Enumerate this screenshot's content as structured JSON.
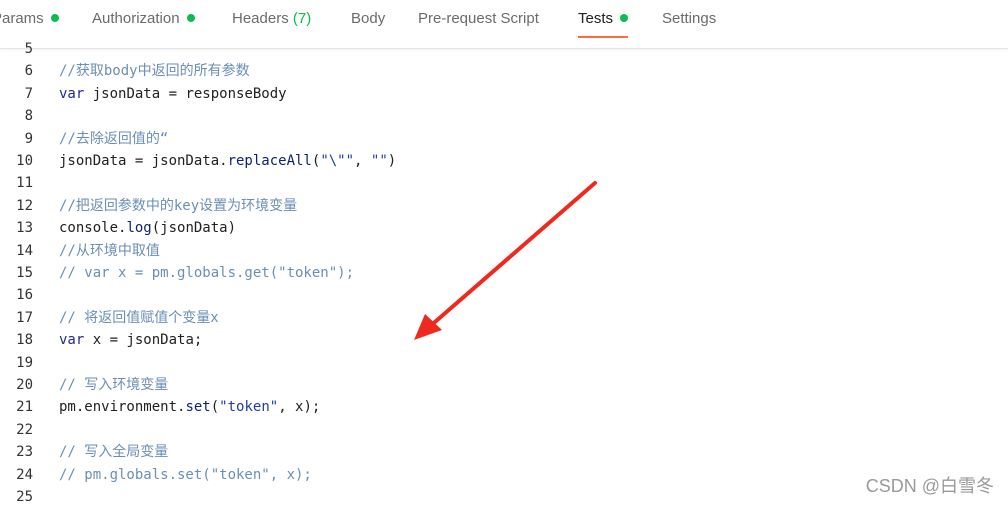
{
  "tabs": [
    {
      "label": "Params",
      "dot": true
    },
    {
      "label": "Authorization",
      "dot": true
    },
    {
      "label": "Headers",
      "count": "(7)"
    },
    {
      "label": "Body"
    },
    {
      "label": "Pre-request Script"
    },
    {
      "label": "Tests",
      "dot": true,
      "active": true
    },
    {
      "label": "Settings"
    }
  ],
  "lines": [
    {
      "n": "5",
      "t": ""
    },
    {
      "n": "6",
      "t": "//获取body中返回的所有参数"
    },
    {
      "n": "7",
      "t": "var jsonData = responseBody"
    },
    {
      "n": "8",
      "t": ""
    },
    {
      "n": "9",
      "t": "//去除返回值的“"
    },
    {
      "n": "10",
      "t": "jsonData = jsonData.replaceAll(\"\\\"\", \"\")"
    },
    {
      "n": "11",
      "t": ""
    },
    {
      "n": "12",
      "t": "//把返回参数中的key设置为环境变量"
    },
    {
      "n": "13",
      "t": "console.log(jsonData)"
    },
    {
      "n": "14",
      "t": "//从环境中取值"
    },
    {
      "n": "15",
      "t": "// var x = pm.globals.get(\"token\");"
    },
    {
      "n": "16",
      "t": ""
    },
    {
      "n": "17",
      "t": "// 将返回值赋值个变量x"
    },
    {
      "n": "18",
      "t": "var x = jsonData;"
    },
    {
      "n": "19",
      "t": ""
    },
    {
      "n": "20",
      "t": "// 写入环境变量"
    },
    {
      "n": "21",
      "t": "pm.environment.set(\"token\", x);"
    },
    {
      "n": "22",
      "t": ""
    },
    {
      "n": "23",
      "t": "// 写入全局变量"
    },
    {
      "n": "24",
      "t": "// pm.globals.set(\"token\", x);"
    },
    {
      "n": "25",
      "t": ""
    }
  ],
  "watermark": "CSDN @白雪冬",
  "colors": {
    "accent": "#ff6c37",
    "status_dot": "#0cbb52",
    "annotation_arrow": "#ee2a1f"
  }
}
